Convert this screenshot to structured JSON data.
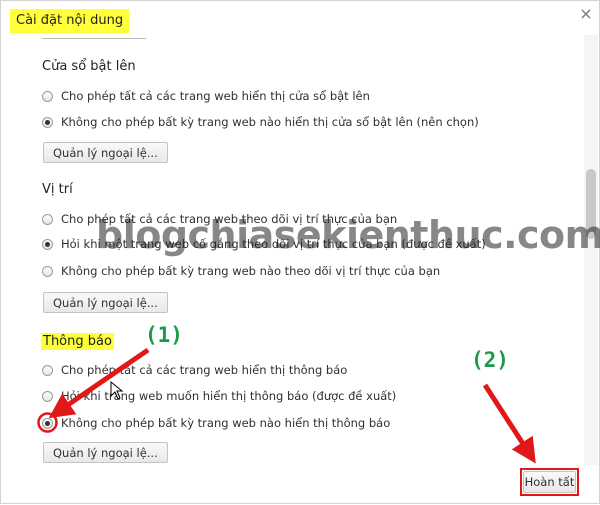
{
  "dialog": {
    "title": "Cài đặt nội dung",
    "close_glyph": "×",
    "done_label": "Hoàn tất"
  },
  "popups": {
    "heading": "Cửa sổ bật lên",
    "option_allow": "Cho phép tất cả các trang web hiển thị cửa sổ bật lên",
    "option_block": "Không cho phép bất kỳ trang web nào hiển thị cửa sổ bật lên (nên chọn)",
    "selected": "block",
    "manage_label": "Quản lý ngoại lệ..."
  },
  "location": {
    "heading": "Vị trí",
    "option_allow": "Cho phép tất cả các trang web theo dõi vị trí thực của bạn",
    "option_ask": "Hỏi khi một trang web cố gắng theo dõi vị trí thực của bạn (được đề xuất)",
    "option_block": "Không cho phép bất kỳ trang web nào theo dõi vị trí thực của bạn",
    "selected": "ask",
    "manage_label": "Quản lý ngoại lệ..."
  },
  "notifications": {
    "heading": "Thông báo",
    "option_allow": "Cho phép tất cả các trang web hiển thị thông báo",
    "option_ask": "Hỏi khi trang web muốn hiển thị thông báo (được đề xuất)",
    "option_block": "Không cho phép bất kỳ trang web nào hiển thị thông báo",
    "selected": "block",
    "manage_label": "Quản lý ngoại lệ..."
  },
  "annotations": {
    "step1": "(1)",
    "step2": "(2)",
    "arrow_color": "#e01818",
    "label_color": "#1a9a4a"
  },
  "watermark": "blogchiasekienthuc.com"
}
